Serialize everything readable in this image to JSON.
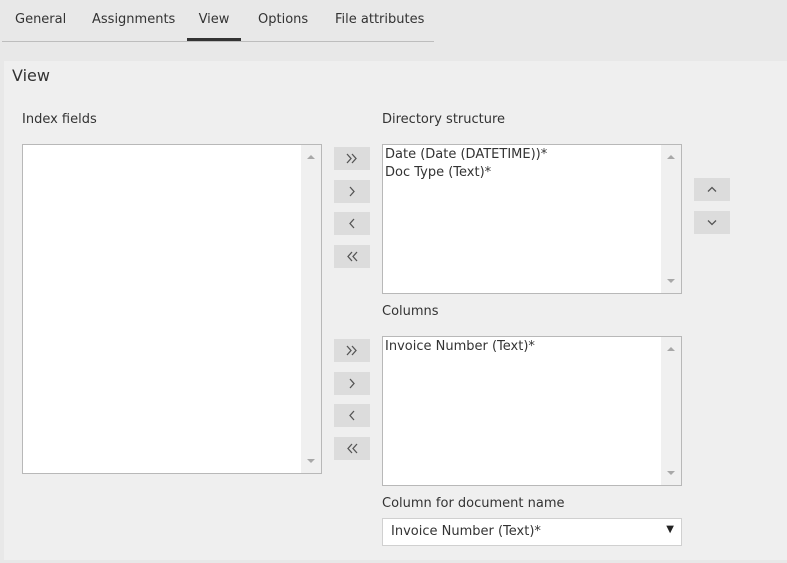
{
  "tabs": [
    {
      "label": "General"
    },
    {
      "label": "Assignments"
    },
    {
      "label": "View",
      "active": true
    },
    {
      "label": "Options"
    },
    {
      "label": "File attributes"
    }
  ],
  "panel": {
    "title": "View"
  },
  "index_fields": {
    "label": "Index fields",
    "items": []
  },
  "directory_structure": {
    "label": "Directory structure",
    "items": [
      "Date (Date (DATETIME))*",
      "Doc Type (Text)*"
    ]
  },
  "columns": {
    "label": "Columns",
    "items": [
      "Invoice Number (Text)*"
    ]
  },
  "document_name": {
    "label": "Column for document name",
    "value": "Invoice Number (Text)*"
  },
  "icons": {
    "add_all": "double-chevron-right-icon",
    "add": "chevron-right-icon",
    "remove": "chevron-left-icon",
    "remove_all": "double-chevron-left-icon",
    "move_up": "chevron-up-icon",
    "move_down": "chevron-down-icon"
  },
  "colors": {
    "panel_bg": "#efefef",
    "page_bg": "#e8e8e8",
    "button_bg": "#dcdcdc"
  }
}
